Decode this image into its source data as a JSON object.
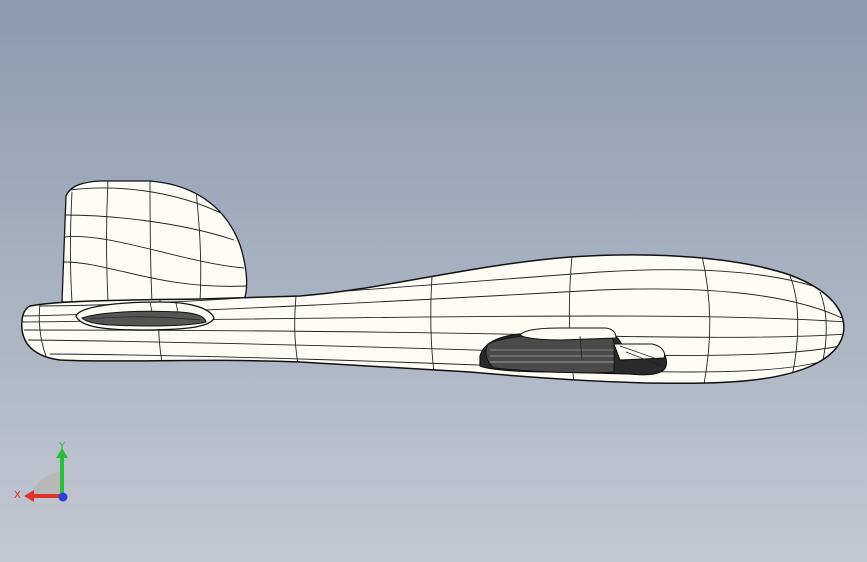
{
  "viewport": {
    "background_top": "#8b9bb0",
    "background_bottom": "#c4c8d2",
    "model_fill": "#fdfdf6",
    "edge_color": "#111111",
    "shadow_color": "#3a3a3a"
  },
  "triad": {
    "x_label": "X",
    "y_label": "Y",
    "x_color": "#e0302a",
    "y_color": "#2dbb3a",
    "z_color": "#2a3fd9"
  }
}
